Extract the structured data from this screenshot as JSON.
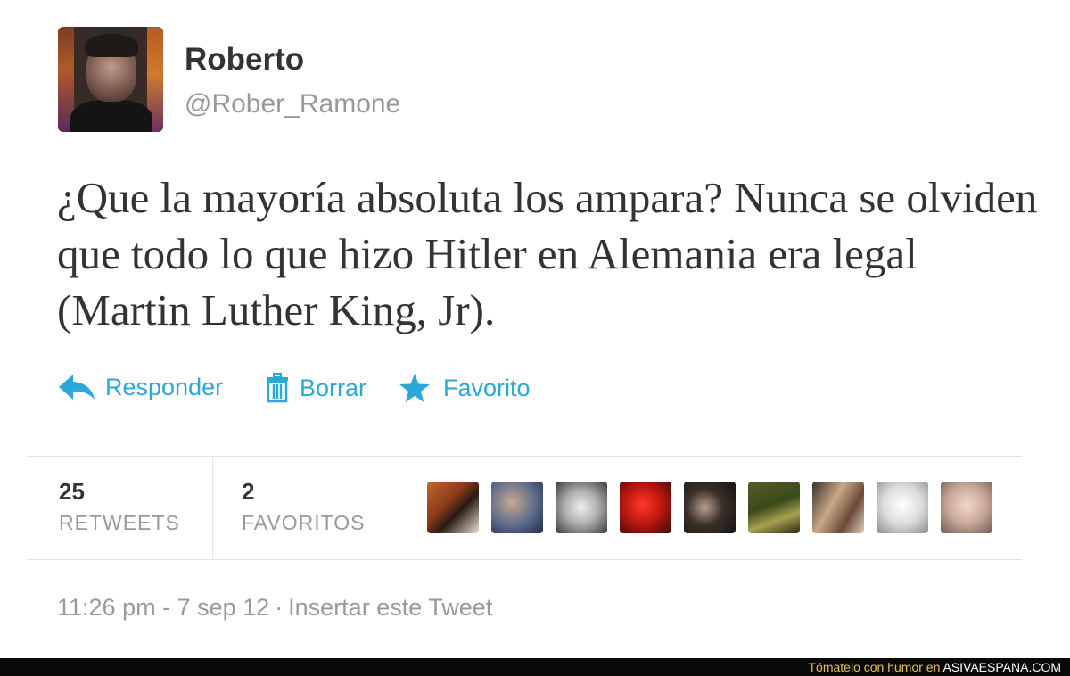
{
  "user": {
    "name": "Roberto",
    "handle": "@Rober_Ramone"
  },
  "tweet": {
    "text": "¿Que la mayoría absoluta los ampara? Nunca se olviden que todo lo que hizo Hitler en Alemania era legal (Martin Luther King, Jr).",
    "timestamp": "11:26 pm - 7 sep 12",
    "embed_link": "Insertar este Tweet"
  },
  "actions": {
    "reply": "Responder",
    "delete": "Borrar",
    "favorite": "Favorito"
  },
  "stats": {
    "retweets_count": "25",
    "retweets_label": "RETWEETS",
    "favorites_count": "2",
    "favorites_label": "FAVORITOS"
  },
  "banner": {
    "prefix": "Tómatelo con humor en",
    "site": "ASIVAESPANA.COM"
  },
  "colors": {
    "action": "#2aa8d8",
    "text": "#333333",
    "muted": "#999999",
    "banner_bg": "#0a0a0a",
    "banner_text": "#e8c24a"
  },
  "icons": [
    "reply-icon",
    "trash-icon",
    "star-icon"
  ]
}
